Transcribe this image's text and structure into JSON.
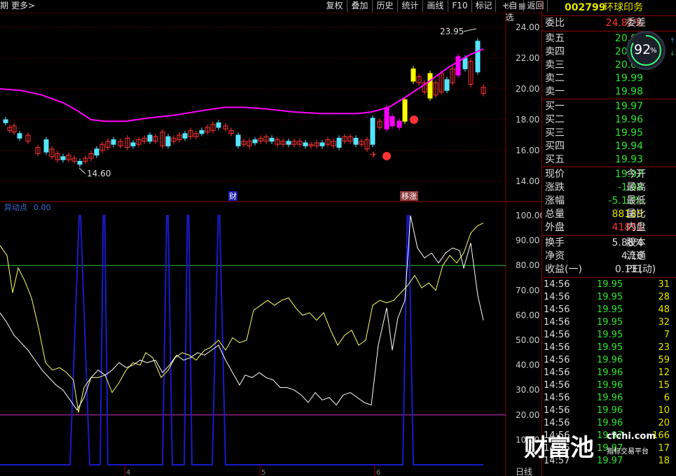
{
  "toolbar": {
    "left_label": "期",
    "more_label": "更多>",
    "buttons": [
      "复权",
      "叠加",
      "历史",
      "统计",
      "画线",
      "F10",
      "标记",
      "+自选",
      "返回"
    ]
  },
  "stock": {
    "code": "002799",
    "name": "环球印务"
  },
  "weibi": {
    "label": "委比",
    "value": "24.81%",
    "label2": "委差"
  },
  "sell": [
    {
      "label": "卖五",
      "price": "20.02"
    },
    {
      "label": "卖四",
      "price": "20.01"
    },
    {
      "label": "卖三",
      "price": "20.00"
    },
    {
      "label": "卖二",
      "price": "19.99"
    },
    {
      "label": "卖一",
      "price": "19.98"
    }
  ],
  "buy": [
    {
      "label": "买一",
      "price": "19.97"
    },
    {
      "label": "买二",
      "price": "19.96"
    },
    {
      "label": "买三",
      "price": "19.95"
    },
    {
      "label": "买四",
      "price": "19.94"
    },
    {
      "label": "买五",
      "price": "19.93"
    }
  ],
  "quote": [
    {
      "label": "现价",
      "value": "19.97",
      "label2": "今开",
      "color": "green"
    },
    {
      "label": "涨跌",
      "value": "-1.08",
      "label2": "最高",
      "color": "green"
    },
    {
      "label": "涨幅",
      "value": "-5.13%",
      "label2": "最低",
      "color": "green"
    },
    {
      "label": "总量",
      "value": "88189",
      "label2": "量比",
      "color": "yellow"
    },
    {
      "label": "外盘",
      "value": "41851",
      "label2": "内盘",
      "color": "red"
    }
  ],
  "finance": [
    {
      "label": "换手",
      "value": "5.88%",
      "label2": "股本"
    },
    {
      "label": "净资",
      "value": "4.16",
      "label2": "流通"
    },
    {
      "label": "收益(一)",
      "value": "0.131",
      "label2": "PE(动)"
    }
  ],
  "ticks": [
    {
      "time": "14:56",
      "price": "19.95",
      "vol": "31"
    },
    {
      "time": "14:56",
      "price": "19.95",
      "vol": "28"
    },
    {
      "time": "14:56",
      "price": "19.95",
      "vol": "48"
    },
    {
      "time": "14:56",
      "price": "19.95",
      "vol": "32"
    },
    {
      "time": "14:56",
      "price": "19.95",
      "vol": "7"
    },
    {
      "time": "14:56",
      "price": "19.95",
      "vol": "23"
    },
    {
      "time": "14:56",
      "price": "19.96",
      "vol": "59"
    },
    {
      "time": "14:56",
      "price": "19.96",
      "vol": "12"
    },
    {
      "time": "14:56",
      "price": "19.96",
      "vol": "15"
    },
    {
      "time": "14:56",
      "price": "19.96",
      "vol": "6"
    },
    {
      "time": "14:56",
      "price": "19.96",
      "vol": "10"
    },
    {
      "time": "14:56",
      "price": "19.96",
      "vol": "20"
    },
    {
      "time": "14:56",
      "price": "19.97",
      "vol": "166"
    },
    {
      "time": "14:56",
      "price": "19.97",
      "vol": "17"
    },
    {
      "time": "14:57",
      "price": "19.97",
      "vol": "18"
    }
  ],
  "gauge": {
    "value": "92",
    "unit": "%"
  },
  "chart_labels": {
    "price_axis": [
      "24.00",
      "22.00",
      "20.00",
      "18.00",
      "16.00",
      "14.00"
    ],
    "ind_axis": [
      "100.00",
      "90.00",
      "80.00",
      "70.00",
      "60.00",
      "50.00",
      "40.00",
      "30.00",
      "20.00",
      "10.00"
    ],
    "high_mark": "23.95",
    "low_mark": "14.60",
    "indicator_name": "异动点",
    "indicator_value": "0.00",
    "cai_label": "财",
    "lianzhang_label": "移涨",
    "bottom_right": "日线",
    "x_ticks": [
      "4",
      "5",
      "6"
    ]
  },
  "watermark": {
    "brand": "财富池",
    "site": "cfchi.com",
    "tagline": "指标交易平台"
  },
  "colors": {
    "up": "#ff3333",
    "down": "#2ee52e",
    "ma": "#ff00ff",
    "cyan": "#55e5ff",
    "ind_white": "#ffffff",
    "ind_yellow": "#ffff66",
    "ind_blue": "#1a1acc"
  }
}
